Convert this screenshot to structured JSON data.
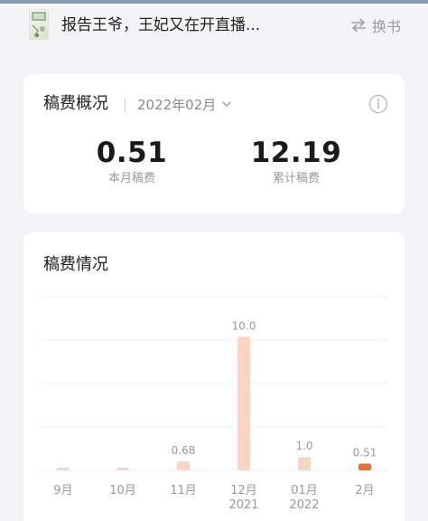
{
  "header": {
    "book_title": "报告王爷，王妃又在开直播...",
    "switch_label": "换书",
    "cover_icon": "book-cover-thumbnail",
    "switch_icon": "swap-arrows-icon"
  },
  "summary": {
    "title": "稿费概况",
    "month": "2022年02月",
    "month_icon": "chevron-down-icon",
    "info_icon": "info-icon",
    "this_month_value": "0.51",
    "this_month_label": "本月稿费",
    "total_value": "12.19",
    "total_label": "累计稿费"
  },
  "chart_section": {
    "title": "稿费情况"
  },
  "colors": {
    "bar": "#fbd5c3",
    "bar_current": "#f06d32",
    "value_label": "#9a9a9a",
    "axis_label": "#9a9a9a",
    "gridline": "#eeeeee",
    "background": "#f4f4f6"
  },
  "chart_data": {
    "type": "bar",
    "categories": [
      "9月",
      "10月",
      "11月",
      "12月\n2021",
      "01月\n2022",
      "2月"
    ],
    "values": [
      0.05,
      0.05,
      0.68,
      10.0,
      1.0,
      0.51
    ],
    "value_labels": [
      "",
      "",
      "0.68",
      "10.0",
      "1.0",
      "0.51"
    ],
    "highlight_index": 5,
    "ylim": [
      0,
      13
    ],
    "grid": true,
    "title": "",
    "xlabel": "",
    "ylabel": ""
  }
}
